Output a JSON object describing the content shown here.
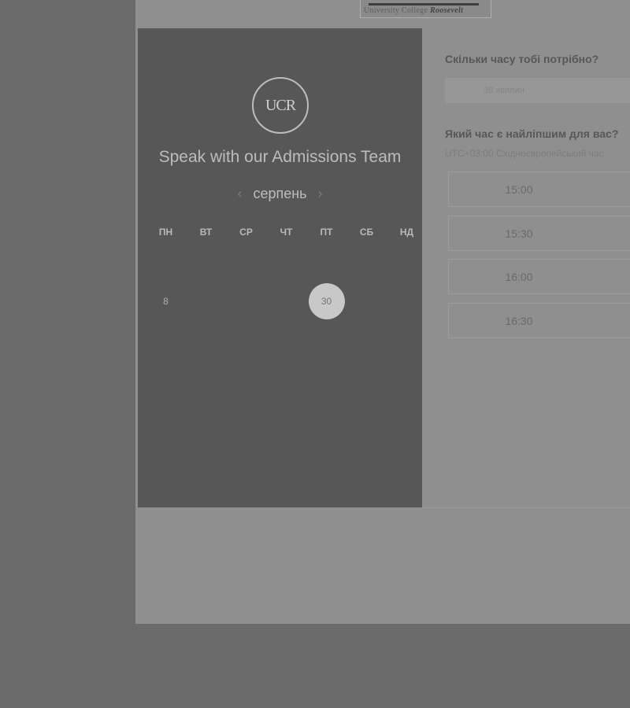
{
  "header": {
    "logo_caption_plain": "University College",
    "logo_caption_bold": "Roosevelt"
  },
  "panel": {
    "emblem_text": "UCR",
    "title": "Speak with our Admissions Team",
    "month": "серпень",
    "prev_icon": "chevron-left-icon",
    "next_icon": "chevron-right-icon",
    "weekdays": [
      "ПН",
      "ВТ",
      "СР",
      "ЧТ",
      "ПТ",
      "СБ",
      "НД"
    ],
    "selected_day": "30"
  },
  "booking": {
    "duration_question": "Скільки часу тобі потрібно?",
    "duration_value": "30 хвилин",
    "time_question": "Який час є найліпшим для вас?",
    "timezone": "UTC+03:00 Східноєвропейський час",
    "slots": [
      "15:00",
      "15:30",
      "16:00",
      "16:30"
    ]
  }
}
